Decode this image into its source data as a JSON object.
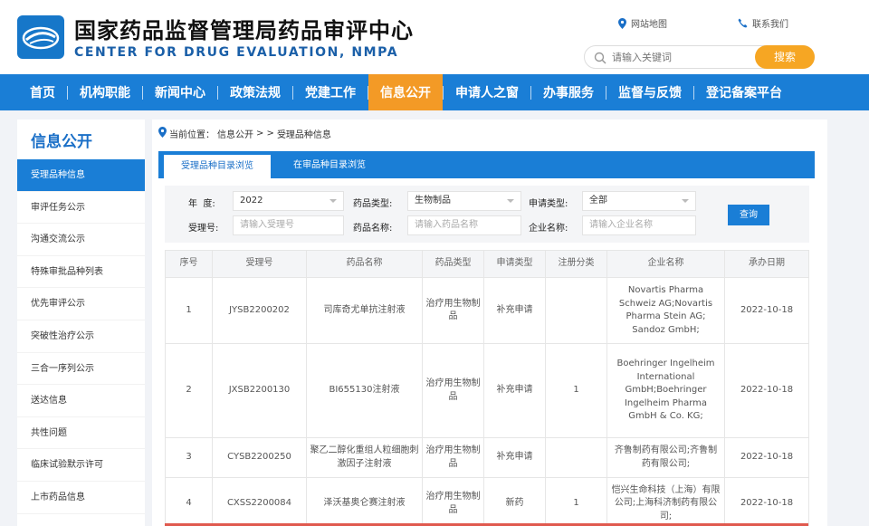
{
  "header": {
    "title": "国家药品监督管理局药品审评中心",
    "subtitle": "CENTER FOR DRUG EVALUATION, NMPA",
    "sitemap": "网站地图",
    "contact": "联系我们",
    "search_placeholder": "请输入关键词",
    "search_button": "搜索"
  },
  "nav": {
    "items": [
      "首页",
      "机构职能",
      "新闻中心",
      "政策法规",
      "党建工作",
      "信息公开",
      "申请人之窗",
      "办事服务",
      "监督与反馈",
      "登记备案平台"
    ],
    "active": "信息公开"
  },
  "sidebar": {
    "title": "信息公开",
    "items": [
      "受理品种信息",
      "审评任务公示",
      "沟通交流公示",
      "特殊审批品种列表",
      "优先审评公示",
      "突破性治疗公示",
      "三合一序列公示",
      "送达信息",
      "共性问题",
      "临床试验默示许可",
      "上市药品信息"
    ],
    "active": "受理品种信息"
  },
  "breadcrumb": {
    "prefix": "当前位置：",
    "level1": "信息公开",
    "arrows": "> >",
    "level2": "受理品种信息"
  },
  "tabs": [
    "受理品种目录浏览",
    "在审品种目录浏览"
  ],
  "filters": {
    "year_label": "年  度:",
    "year_value": "2022",
    "drug_type_label": "药品类型:",
    "drug_type_value": "生物制品",
    "apply_type_label": "申请类型:",
    "apply_type_value": "全部",
    "accept_no_label": "受理号:",
    "accept_no_placeholder": "请输入受理号",
    "drug_name_label": "药品名称:",
    "drug_name_placeholder": "请输入药品名称",
    "company_label": "企业名称:",
    "company_placeholder": "请输入企业名称",
    "query_button": "查询"
  },
  "table": {
    "headers": [
      "序号",
      "受理号",
      "药品名称",
      "药品类型",
      "申请类型",
      "注册分类",
      "企业名称",
      "承办日期"
    ],
    "rows": [
      [
        "1",
        "JYSB2200202",
        "司库奇尤单抗注射液",
        "治疗用生物制品",
        "补充申请",
        "",
        "Novartis Pharma Schweiz AG;Novartis Pharma Stein AG; Sandoz GmbH;",
        "2022-10-18"
      ],
      [
        "2",
        "JXSB2200130",
        "BI655130注射液",
        "治疗用生物制品",
        "补充申请",
        "1",
        "Boehringer Ingelheim International GmbH;Boehringer Ingelheim Pharma GmbH & Co. KG;",
        "2022-10-18"
      ],
      [
        "3",
        "CYSB2200250",
        "聚乙二醇化重组人粒细胞刺激因子注射液",
        "治疗用生物制品",
        "补充申请",
        "",
        "齐鲁制药有限公司;齐鲁制药有限公司;",
        "2022-10-18"
      ],
      [
        "4",
        "CXSS2200084",
        "泽沃基奥仑赛注射液",
        "治疗用生物制品",
        "新药",
        "1",
        "恺兴生命科技（上海）有限公司;上海科济制药有限公司;",
        "2022-10-18"
      ]
    ]
  },
  "colors": {
    "primary": "#1a7ed6",
    "accent": "#f39a26",
    "search_button": "#f6a623"
  }
}
